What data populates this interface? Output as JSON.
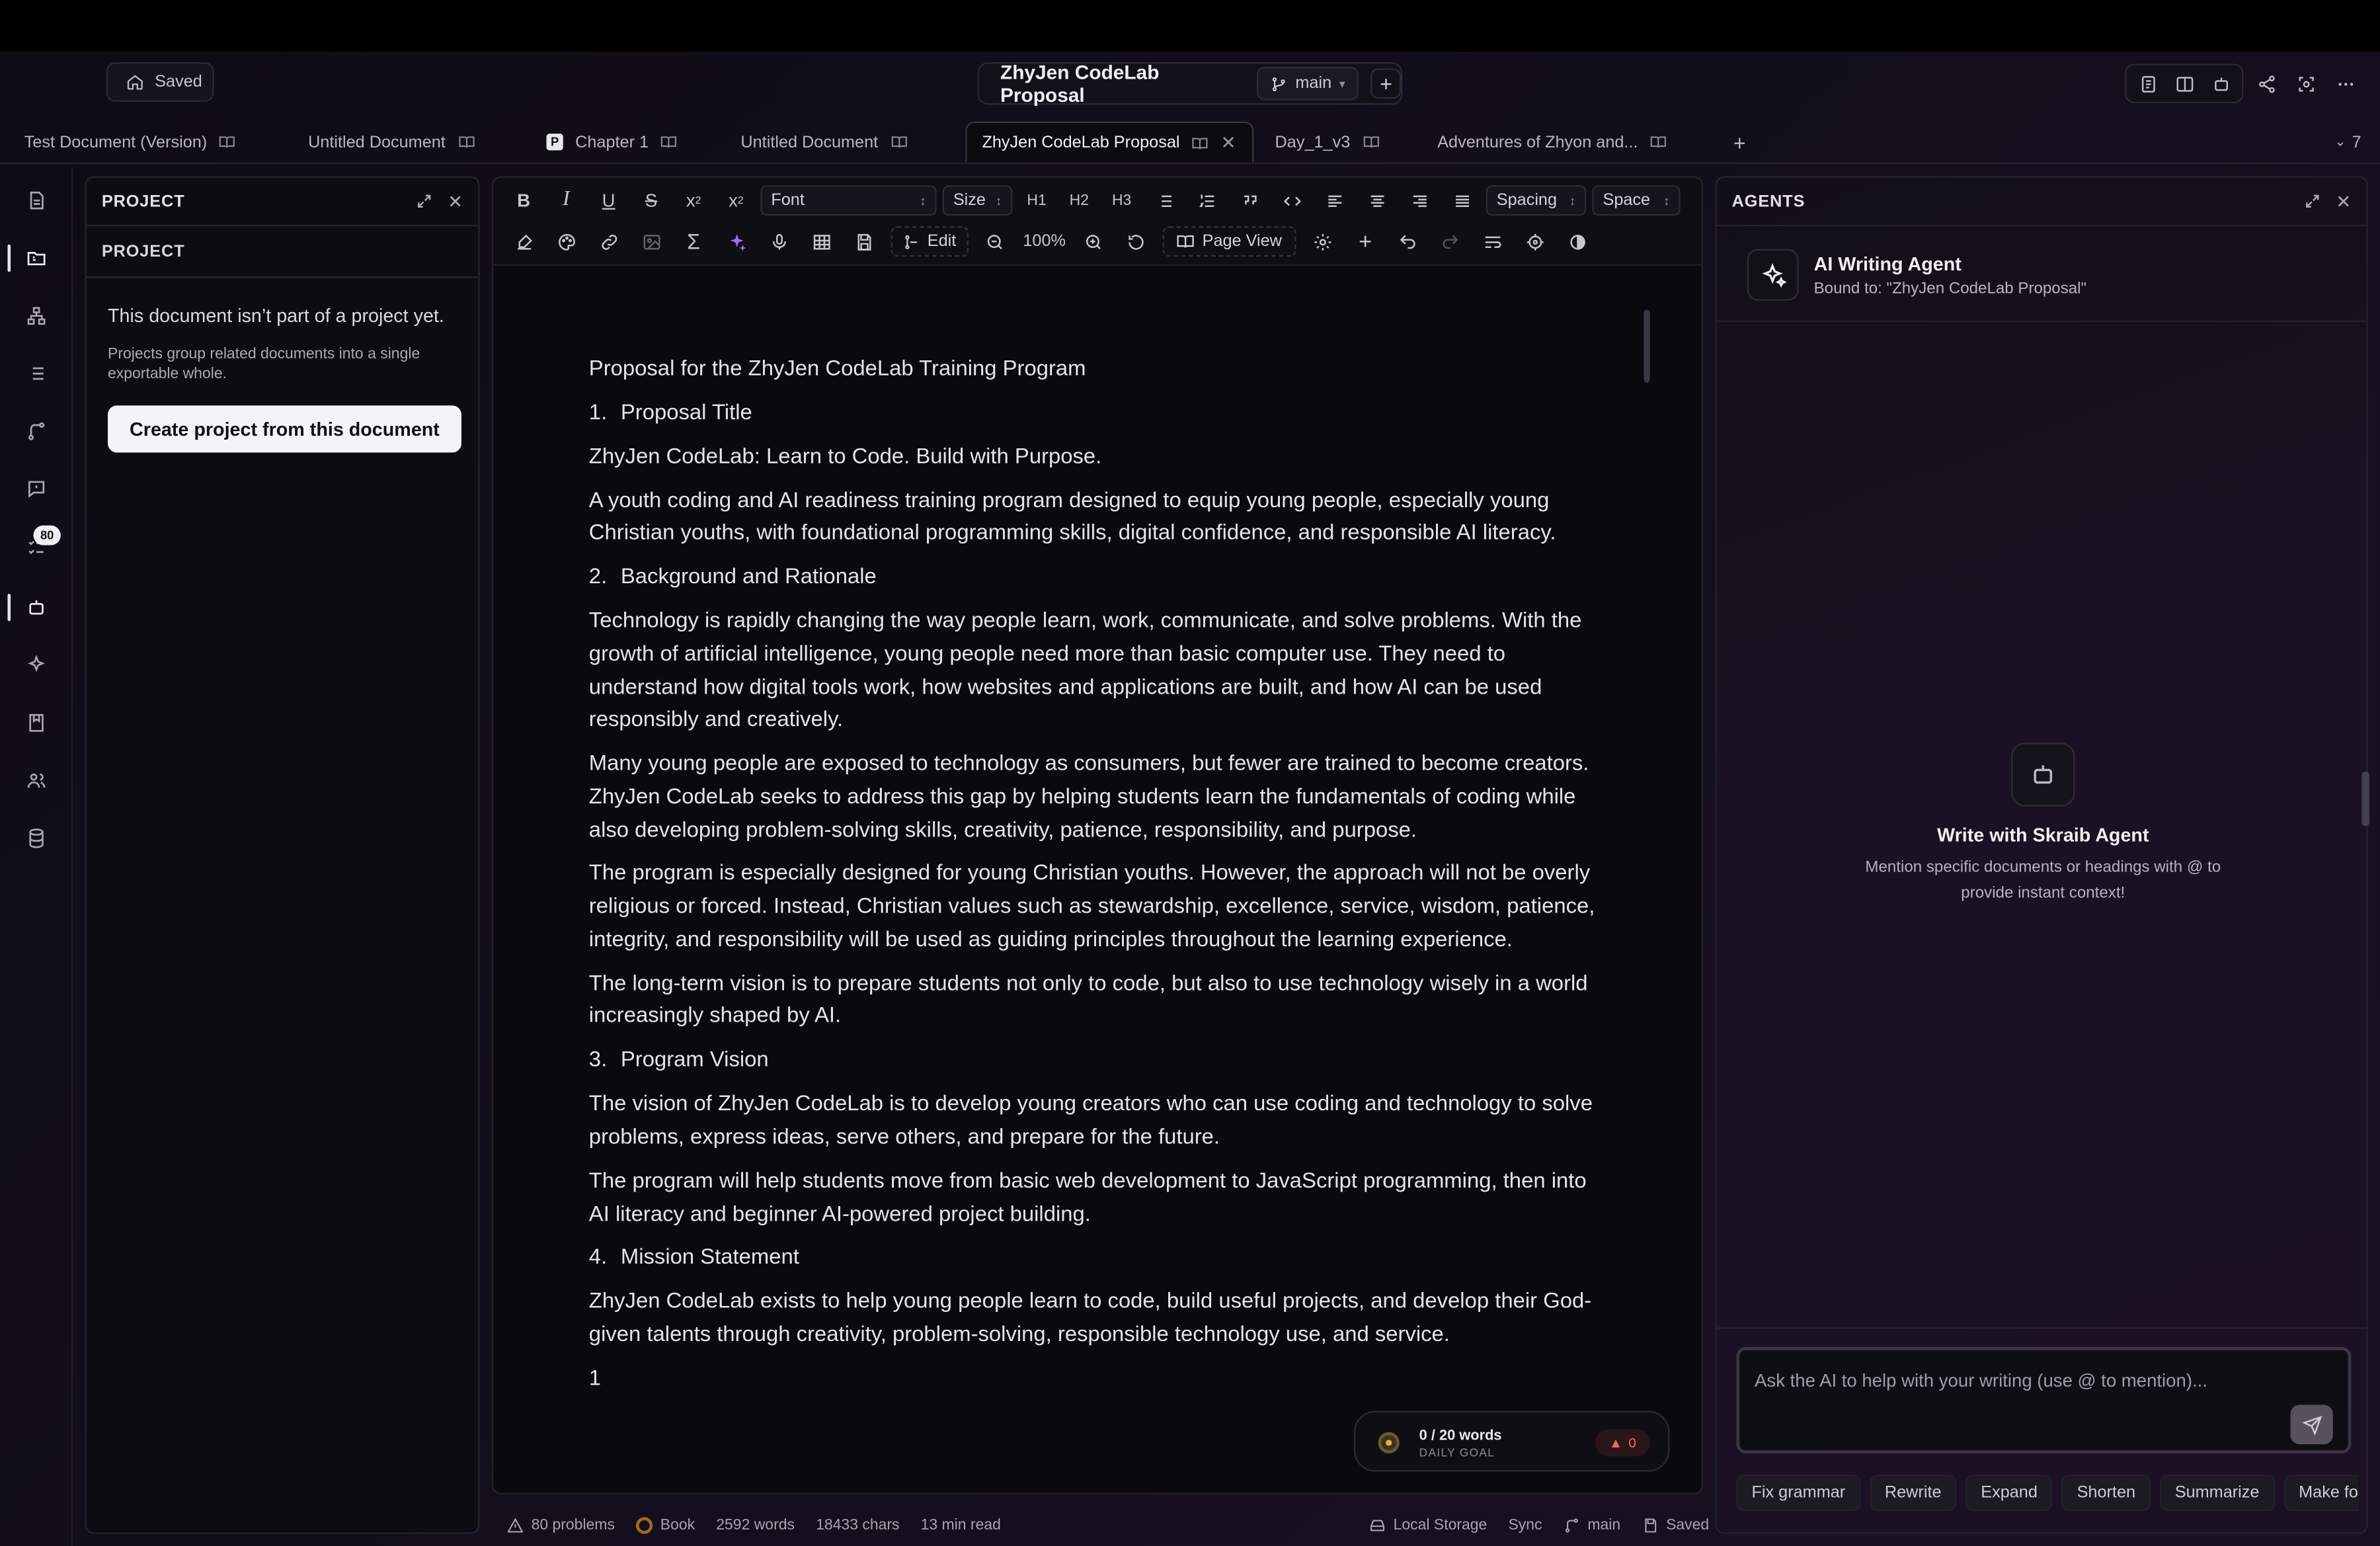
{
  "titlebar": {
    "saved": "Saved",
    "doc_title": "ZhyJen CodeLab Proposal",
    "branch": "main",
    "plus": "+"
  },
  "tabs": [
    {
      "label": "Test Document (Version)"
    },
    {
      "label": "Untitled Document"
    },
    {
      "label": "Chapter 1"
    },
    {
      "label": "Untitled Document"
    },
    {
      "label": "ZhyJen CodeLab Proposal"
    },
    {
      "label": "Day_1_v3"
    },
    {
      "label": "Adventures of Zhyon and..."
    }
  ],
  "tabs_overflow": "7",
  "tab_add": "+",
  "chapter_icon_letter": "P",
  "rail": {
    "badge": "80"
  },
  "project": {
    "header": "PROJECT",
    "sub": "PROJECT",
    "message": "This document isn’t part of a project yet.",
    "hint": "Projects group related documents into a single exportable whole.",
    "button": "Create project from this document"
  },
  "toolbar": {
    "font": "Font",
    "size": "Size",
    "h1": "H1",
    "h2": "H2",
    "h3": "H3",
    "spacing": "Spacing",
    "space": "Space",
    "edit": "Edit",
    "zoom": "100%",
    "page_view": "Page View"
  },
  "doc": {
    "title": "Proposal for the ZhyJen CodeLab Training Program",
    "s1_num": "1.",
    "s1": "Proposal Title",
    "p1": "ZhyJen CodeLab: Learn to Code. Build with Purpose.",
    "p2": "A youth coding and AI readiness training program designed to equip young people, especially young Christian youths, with foundational programming skills, digital confidence, and responsible AI literacy.",
    "s2_num": "2.",
    "s2": "Background and Rationale",
    "p3": "Technology is rapidly changing the way people learn, work, communicate, and solve problems. With the growth of artificial intelligence, young people need more than basic computer use. They need to understand how digital tools work, how websites and applications are built, and how AI can be used responsibly and creatively.",
    "p4": "Many young people are exposed to technology as consumers, but fewer are trained to become creators. ZhyJen CodeLab seeks to address this gap by helping students learn the fundamentals of coding while also developing problem-solving skills, creativity, patience, responsibility, and purpose.",
    "p5": "The program is especially designed for young Christian youths. However, the approach will not be overly religious or forced. Instead, Christian values such as stewardship, excellence, service, wisdom, patience, integrity, and responsibility will be used as guiding principles throughout the learning experience.",
    "p6": "The long-term vision is to prepare students not only to code, but also to use technology wisely in a world increasingly shaped by AI.",
    "s3_num": "3.",
    "s3": "Program Vision",
    "p7": "The vision of ZhyJen CodeLab is to develop young creators who can use coding and technology to solve problems, express ideas, serve others, and prepare for the future.",
    "p8": "The program will help students move from basic web development to JavaScript programming, then into AI literacy and beginner AI-powered project building.",
    "s4_num": "4.",
    "s4": "Mission Statement",
    "p9": "ZhyJen CodeLab exists to help young people learn to code, build useful projects, and develop their God-given talents through creativity, problem-solving, responsible technology use, and service.",
    "page_num": "1"
  },
  "goal": {
    "words": "0 / 20 words",
    "label": "DAILY GOAL",
    "streak": "0"
  },
  "status": {
    "problems": "80 problems",
    "mode": "Book",
    "words": "2592 words",
    "chars": "18433 chars",
    "read": "13 min read",
    "storage": "Local Storage",
    "sync": "Sync",
    "branch": "main",
    "saved": "Saved"
  },
  "agents": {
    "header": "AGENTS",
    "name": "AI Writing Agent",
    "bound": "Bound to: \"ZhyJen CodeLab Proposal\"",
    "empty_title": "Write with Skraib Agent",
    "empty_desc": "Mention specific documents or headings with @ to provide instant context!",
    "placeholder": "Ask the AI to help with your writing (use @ to mention)...",
    "chips": [
      "Fix grammar",
      "Rewrite",
      "Expand",
      "Shorten",
      "Summarize",
      "Make form"
    ]
  }
}
